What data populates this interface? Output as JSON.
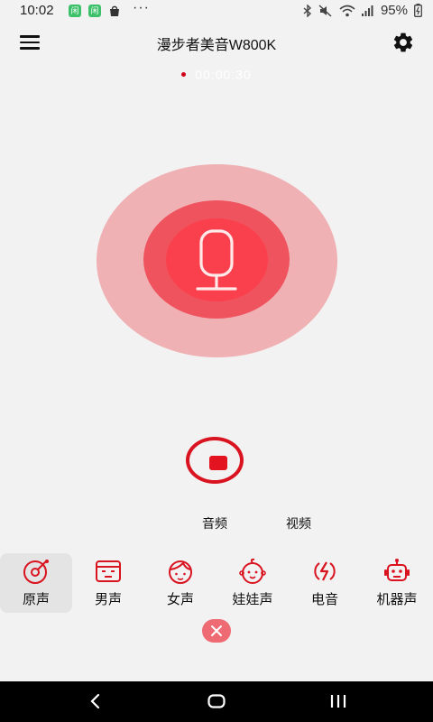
{
  "status_bar": {
    "time": "10:02",
    "badge_glyph": "闲",
    "dots": "···",
    "battery": "95%"
  },
  "header": {
    "title": "漫步者美音W800K"
  },
  "recording": {
    "timer": "00:00:30"
  },
  "mode_tabs": [
    {
      "label": "音频"
    },
    {
      "label": "视频"
    }
  ],
  "voices": [
    {
      "label": "原声",
      "icon": "vinyl-disc-icon",
      "selected": true
    },
    {
      "label": "男声",
      "icon": "male-face-icon",
      "selected": false
    },
    {
      "label": "女声",
      "icon": "female-face-icon",
      "selected": false
    },
    {
      "label": "娃娃声",
      "icon": "baby-face-icon",
      "selected": false
    },
    {
      "label": "电音",
      "icon": "electric-icon",
      "selected": false
    },
    {
      "label": "机器声",
      "icon": "robot-icon",
      "selected": false
    }
  ],
  "colors": {
    "accent": "#e3131f",
    "ring_outer": "#f0b1b4",
    "ring_mid": "#ef535e",
    "ring_inner": "#fb404d",
    "close": "#ef6b73"
  }
}
